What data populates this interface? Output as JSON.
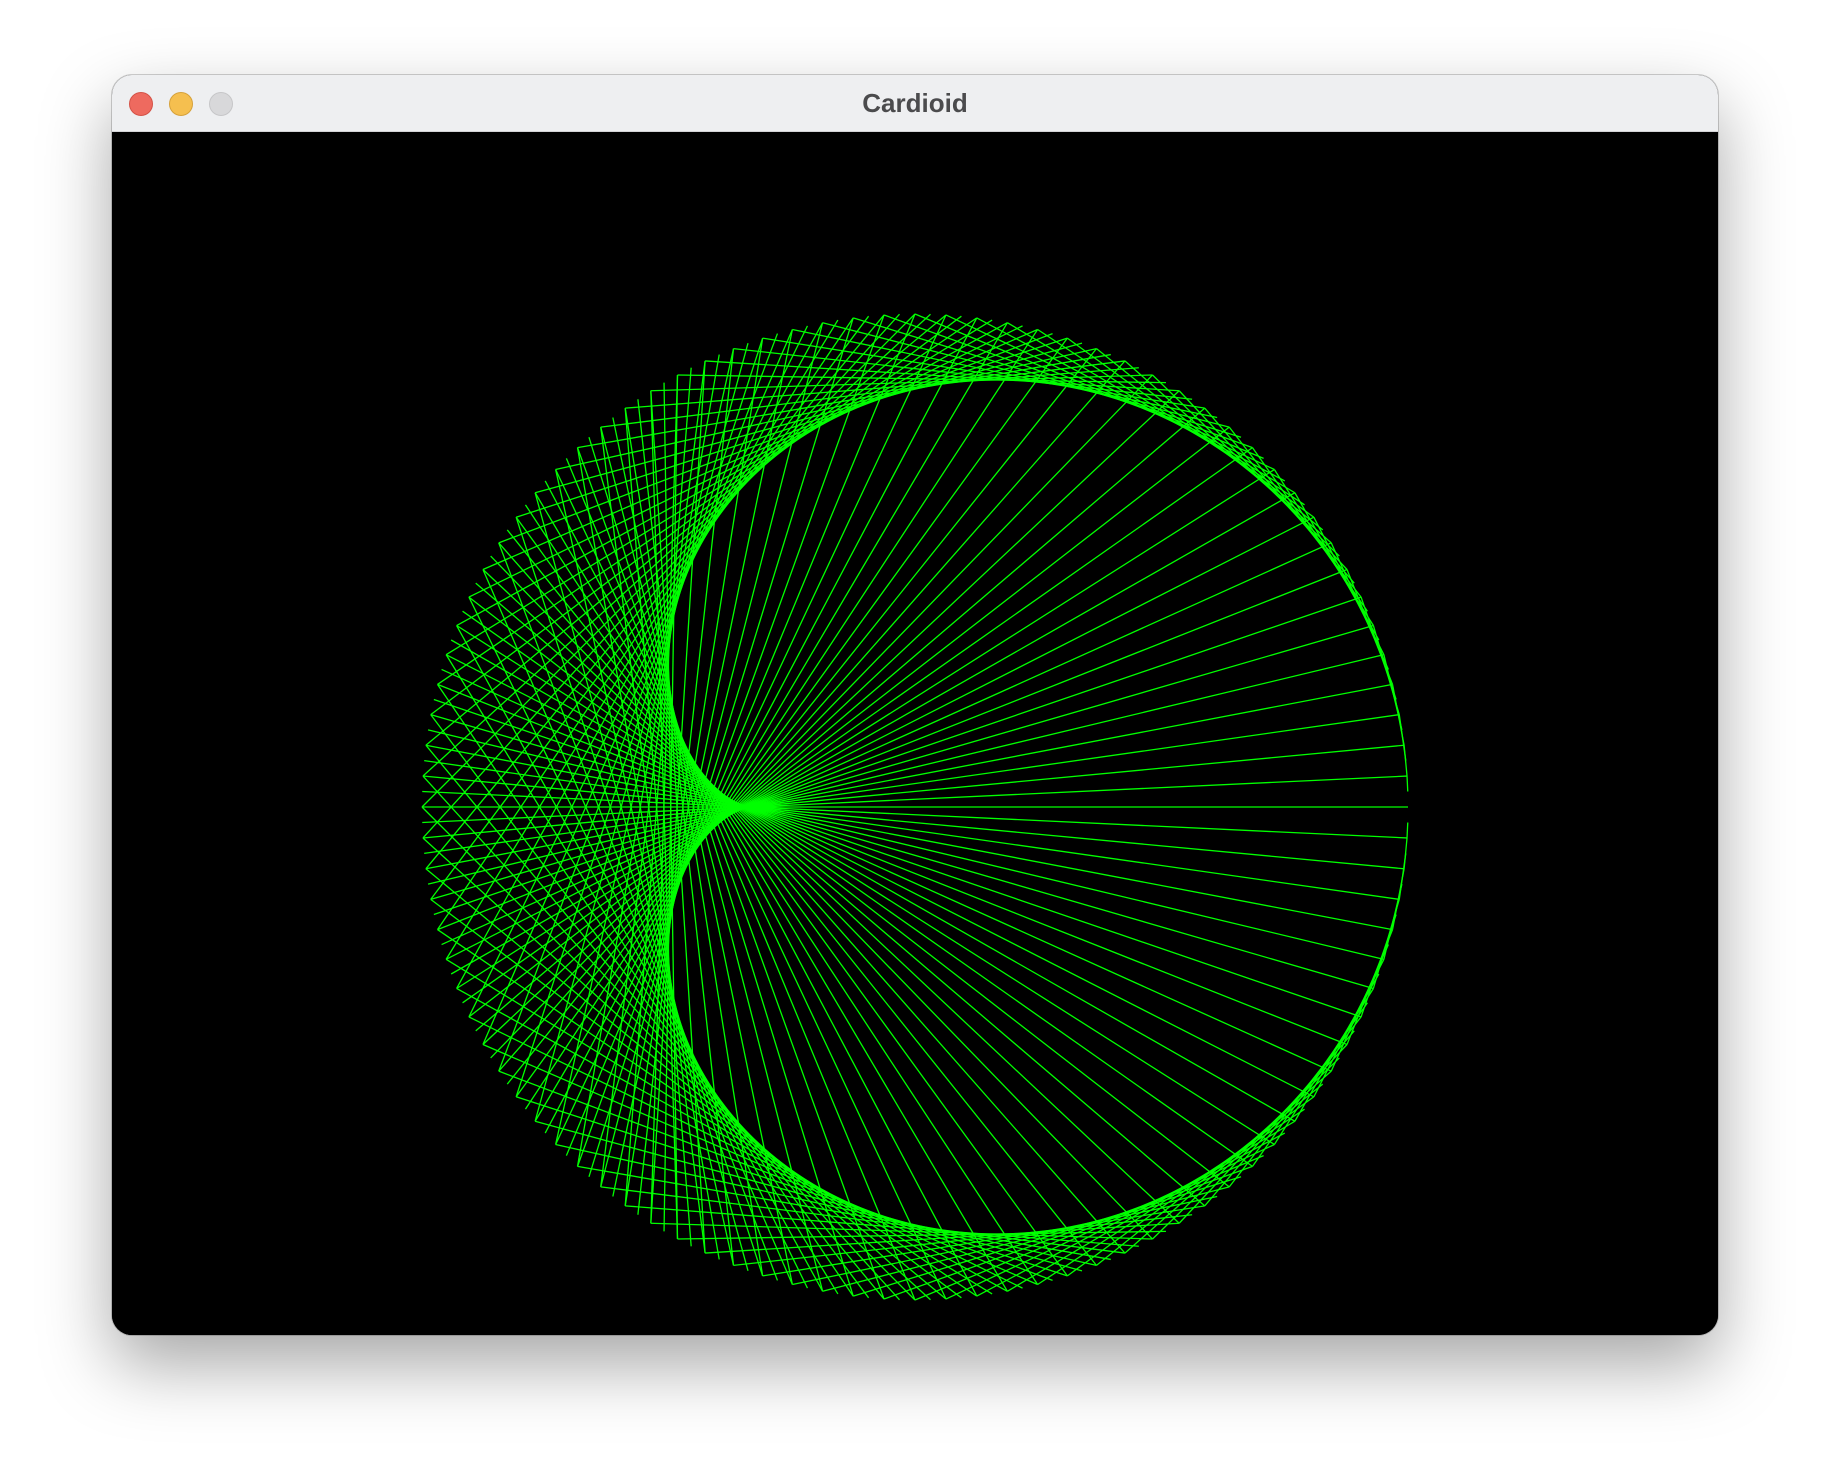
{
  "window": {
    "title": "Cardioid"
  },
  "drawing": {
    "background": "#000000",
    "line_color": "#00ff00",
    "point_count": 200,
    "multiplier": 2,
    "curve": "cardioid"
  }
}
